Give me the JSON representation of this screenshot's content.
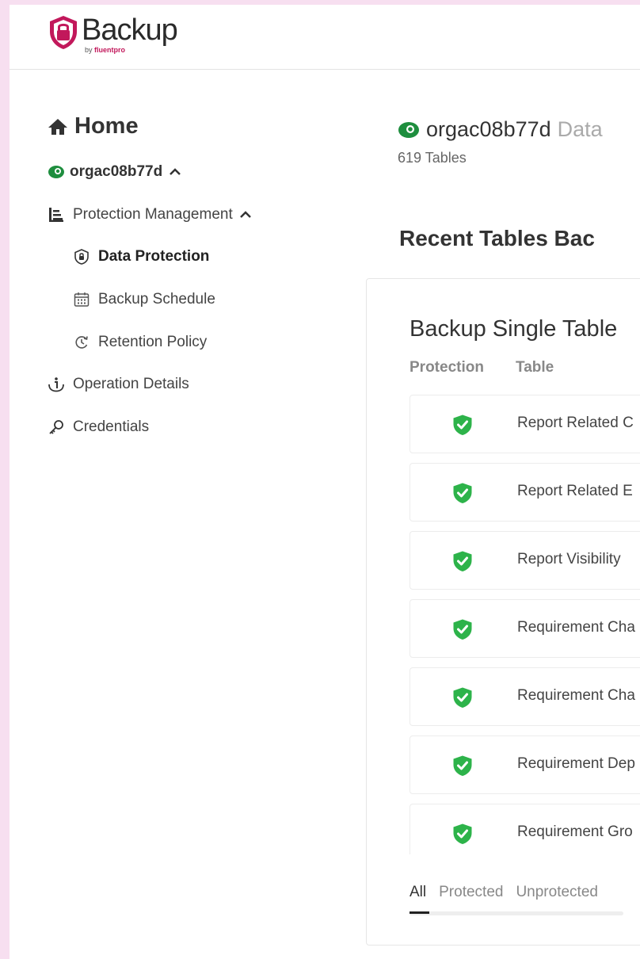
{
  "app": {
    "logo_text": "Backup",
    "logo_by_prefix": "by ",
    "logo_by_brand": "fluentpro"
  },
  "sidebar": {
    "home_label": "Home",
    "org_label": "orgac08b77d",
    "items": [
      {
        "label": "Protection Management",
        "icon": "list-icon"
      },
      {
        "label": "Data Protection",
        "icon": "lock-shield-icon",
        "active": true
      },
      {
        "label": "Backup Schedule",
        "icon": "calendar-icon"
      },
      {
        "label": "Retention Policy",
        "icon": "retention-icon"
      },
      {
        "label": "Operation Details",
        "icon": "info-icon"
      },
      {
        "label": "Credentials",
        "icon": "key-icon"
      }
    ]
  },
  "main": {
    "org_name": "orgac08b77d",
    "org_suffix": "Data",
    "tables_count": "619 Tables",
    "recent_title": "Recent Tables Bac",
    "card": {
      "title": "Backup Single Table",
      "col_protection": "Protection",
      "col_table": "Table",
      "rows": [
        {
          "name": "Report Related C",
          "protected": true
        },
        {
          "name": "Report Related E",
          "protected": true
        },
        {
          "name": "Report Visibility",
          "protected": true
        },
        {
          "name": "Requirement Cha",
          "protected": true
        },
        {
          "name": "Requirement Cha",
          "protected": true
        },
        {
          "name": "Requirement Dep",
          "protected": true
        },
        {
          "name": "Requirement Gro",
          "protected": true
        }
      ],
      "tabs": [
        {
          "label": "All",
          "active": true
        },
        {
          "label": "Protected",
          "active": false
        },
        {
          "label": "Unprotected",
          "active": false
        }
      ]
    }
  },
  "colors": {
    "brand": "#c2185b",
    "shield_green": "#2db34a",
    "org_dot_green": "#1e8e3e"
  }
}
